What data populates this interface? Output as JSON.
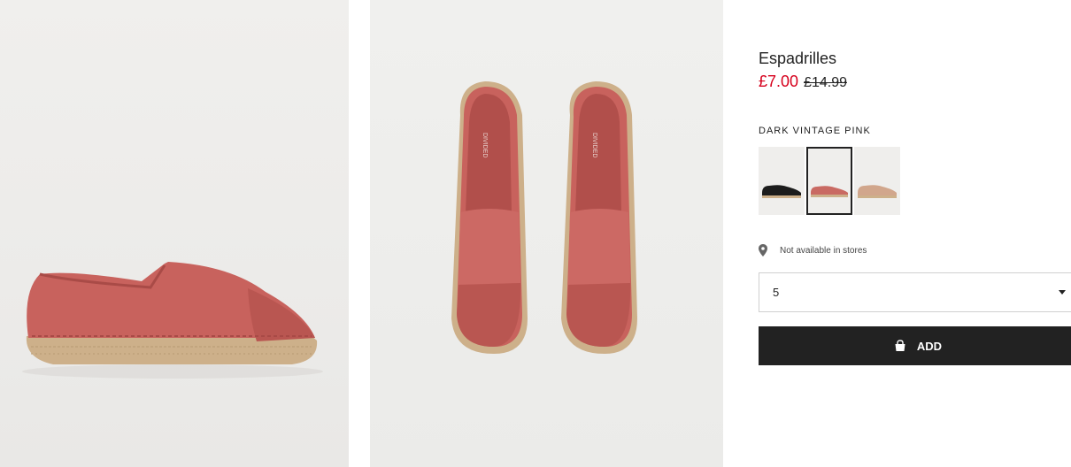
{
  "product": {
    "title": "Espadrilles",
    "sale_price": "£7.00",
    "original_price": "£14.99"
  },
  "colour": {
    "selected_name": "DARK VINTAGE PINK",
    "swatches": [
      {
        "name": "black",
        "color": "#1c1c1c"
      },
      {
        "name": "dark-vintage-pink",
        "color": "#c96a63",
        "selected": true
      },
      {
        "name": "rose-gold",
        "color": "#d1a68c"
      }
    ]
  },
  "availability": {
    "text": "Not available in stores"
  },
  "size": {
    "selected": "5"
  },
  "cart": {
    "add_label": "ADD"
  },
  "colors": {
    "shoe": "#c8625d",
    "shoe_dark": "#a94b47",
    "jute": "#cdb08a",
    "button": "#222222",
    "sale": "#d6001c"
  }
}
